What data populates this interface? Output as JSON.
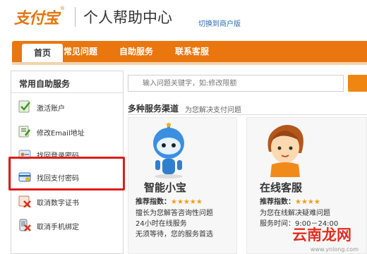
{
  "header": {
    "logo_text": "支付宝",
    "logo_mark": "®",
    "title": "个人帮助中心",
    "switch_link": "切换到商户版"
  },
  "nav": {
    "tabs": [
      {
        "label": "首页",
        "active": true
      },
      {
        "label": "常见问题",
        "active": false
      },
      {
        "label": "自助服务",
        "active": false
      },
      {
        "label": "联系客服",
        "active": false
      }
    ],
    "accent": "#e9760f"
  },
  "sidebar": {
    "title": "常用自助服务",
    "items": [
      {
        "label": "激活账户",
        "icon": "activate-account-icon"
      },
      {
        "label": "修改Email地址",
        "icon": "edit-email-icon"
      },
      {
        "label": "找回登录密码",
        "icon": "recover-login-password-icon"
      },
      {
        "label": "找回支付密码",
        "icon": "recover-payment-password-icon"
      },
      {
        "label": "取消数字证书",
        "icon": "cancel-certificate-icon"
      },
      {
        "label": "取消手机绑定",
        "icon": "cancel-phone-binding-icon"
      }
    ],
    "highlight_color": "#e01b1b"
  },
  "search": {
    "placeholder": "输入问题关键字，如:修改限额"
  },
  "channels": {
    "title": "多种服务渠道",
    "subtitle": "为您解决支付问题",
    "cards": [
      {
        "name": "智能小宝",
        "rating_label": "推荐指数：",
        "stars": "★★★★★",
        "lines": [
          "擅长为您解答咨询性问题",
          "24小时在线服务",
          "无须等待，您的服务首选"
        ]
      },
      {
        "name": "在线客服",
        "rating_label": "推荐指数：",
        "stars": "★★★★",
        "lines": [
          "为您在线解决疑难问题",
          "服务时间：9:00－24:00"
        ]
      }
    ]
  },
  "watermark": {
    "text": "云南龙网",
    "url": "www.ynlong.com"
  }
}
